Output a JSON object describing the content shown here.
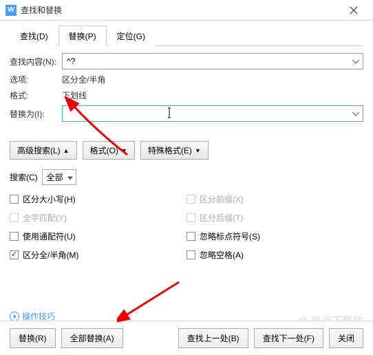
{
  "window": {
    "title": "查找和替换"
  },
  "tabs": {
    "find": "查找(D)",
    "replace": "替换(P)",
    "goto": "定位(G)"
  },
  "fields": {
    "find_label": "查找内容(N):",
    "find_value": "^?",
    "options_label": "选项:",
    "options_value": "区分全/半角",
    "format_label": "格式:",
    "format_value": "下划线",
    "replace_label": "替换为(I):",
    "replace_value": ""
  },
  "buttons": {
    "advanced": "高级搜索(L)",
    "format": "格式(O)",
    "special": "特殊格式(E)",
    "replace_one": "替换(R)",
    "replace_all": "全部替换(A)",
    "find_prev": "查找上一处(B)",
    "find_next": "查找下一处(F)",
    "close": "关闭"
  },
  "scope": {
    "label": "搜索(C)",
    "value": "全部"
  },
  "checkboxes": {
    "case": "区分大小写(H)",
    "whole": "全字匹配(Y)",
    "wildcard": "使用通配符(U)",
    "fullhalf": "区分全/半角(M)",
    "prefix": "区分前缀(X)",
    "suffix": "区分后缀(T)",
    "punct": "忽略标点符号(S)",
    "space": "忽略空格(A)"
  },
  "tips": "操作技巧",
  "watermark": "@ 极光下载站"
}
